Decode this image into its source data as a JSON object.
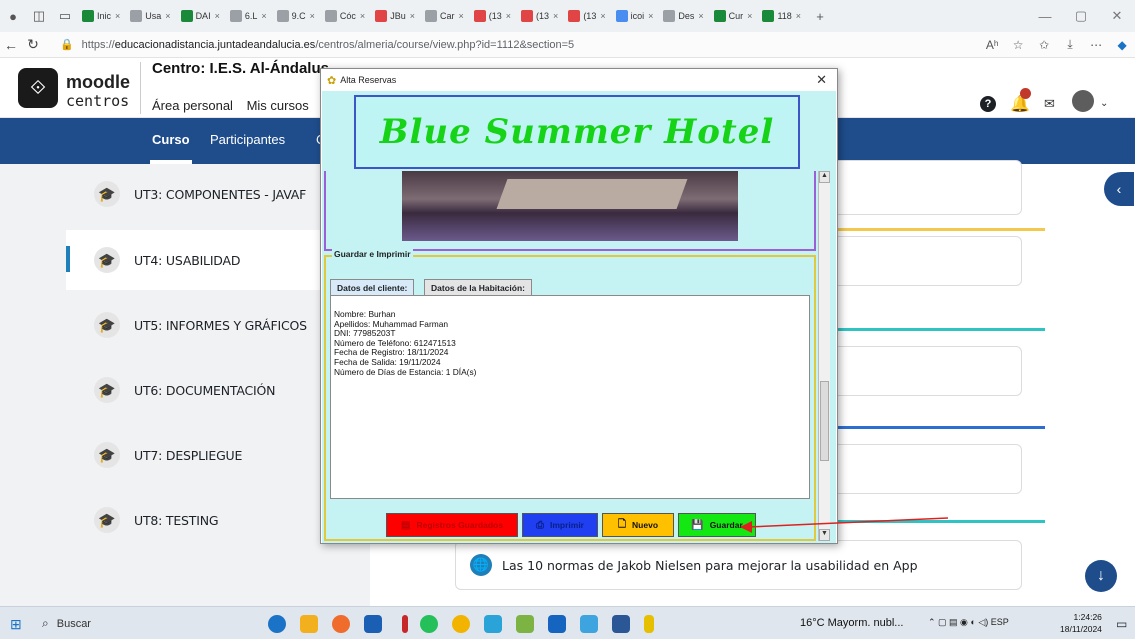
{
  "browser": {
    "tabs": [
      {
        "label": "Inic",
        "color": "#1a8a3a"
      },
      {
        "label": "Usa",
        "color": "#9aa0a6"
      },
      {
        "label": "DAI",
        "color": "#1a8a3a"
      },
      {
        "label": "6.L",
        "color": "#9aa0a6"
      },
      {
        "label": "9.C",
        "color": "#9aa0a6"
      },
      {
        "label": "Cóc",
        "color": "#9aa0a6"
      },
      {
        "label": "JBu",
        "color": "#e04444"
      },
      {
        "label": "Car",
        "color": "#9aa0a6"
      },
      {
        "label": "(13",
        "color": "#e04444"
      },
      {
        "label": "(13",
        "color": "#e04444"
      },
      {
        "label": "(13",
        "color": "#e04444"
      },
      {
        "label": "icoi",
        "color": "#4a8df0"
      },
      {
        "label": "Des",
        "color": "#9aa0a6"
      },
      {
        "label": "Cur",
        "color": "#1a8a3a"
      },
      {
        "label": "118",
        "color": "#1a8a3a"
      }
    ],
    "new_tab": "+",
    "url_prefix": "https://",
    "url_host": "educacionadistancia.juntadeandalucia.es",
    "url_path": "/centros/almeria/course/view.php?id=1112&section=5"
  },
  "moodle": {
    "logo_line1": "moodle",
    "logo_line2": "centros",
    "centro": "Centro: I.E.S. Al-Ándalus",
    "breadcrumbs": [
      "Área personal",
      "Mis cursos"
    ],
    "course_nav": {
      "curso": "Curso",
      "participantes": "Participantes",
      "more": "C"
    },
    "sections": [
      "UT3: COMPONENTES - JAVAF",
      "UT4: USABILIDAD",
      "UT5: INFORMES Y GRÁFICOS",
      "UT6: DOCUMENTACIÓN",
      "UT7: DESPLIEGUE",
      "UT8: TESTING"
    ],
    "link_text": "Las 10 normas de Jakob Nielsen para mejorar la usabilidad en App"
  },
  "dialog": {
    "title": "Alta Reservas",
    "hotel_name": "Blue Summer Hotel",
    "panel_legend": "Guardar e Imprimir",
    "tabs": [
      "Datos del cliente:",
      "Datos de la Habitación:"
    ],
    "client_lines": [
      "Nombre: Burhan",
      "Apellidos: Muhammad Farman",
      "DNI: 77985203T",
      "Número de Teléfono: 612471513",
      "Fecha de Registro: 18/11/2024",
      "Fecha de Salida: 19/11/2024",
      "Número de Días de Estancia: 1 DÍA(s)"
    ],
    "buttons": {
      "registros": "Registros Guardados",
      "imprimir": "Imprimir",
      "nuevo": "Nuevo",
      "guardar": "Guardar"
    }
  },
  "taskbar": {
    "search": "Buscar",
    "weather": "16°C  Mayorm. nubl...",
    "lang": "ESP",
    "time": "1:24:26",
    "date": "18/11/2024"
  }
}
